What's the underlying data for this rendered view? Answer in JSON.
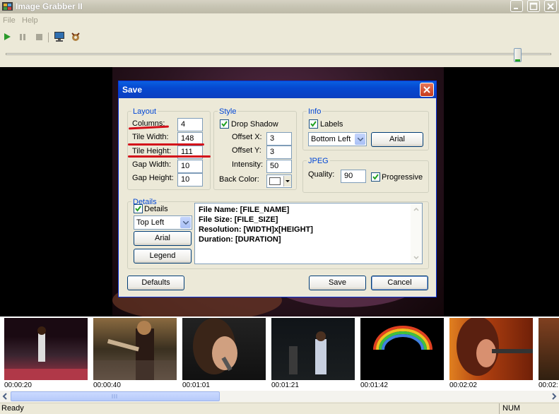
{
  "app": {
    "title": "Image Grabber II"
  },
  "menu": [
    "File",
    "Help"
  ],
  "toolbar": {
    "icons": [
      "play-icon",
      "pause-icon",
      "stop-icon",
      "monitor-icon",
      "settings-icon"
    ]
  },
  "seek": {
    "position": 0.94
  },
  "dialog": {
    "title": "Save",
    "layout": {
      "group": "Layout",
      "columns_label": "Columns:",
      "columns": "4",
      "tile_width_label": "Tile Width:",
      "tile_width": "148",
      "tile_height_label": "Tile Height:",
      "tile_height": "111",
      "gap_width_label": "Gap  Width:",
      "gap_width": "10",
      "gap_height_label": "Gap Height:",
      "gap_height": "10"
    },
    "style": {
      "group": "Style",
      "drop_shadow_label": "Drop Shadow",
      "drop_shadow_checked": true,
      "offset_x_label": "Offset X:",
      "offset_x": "3",
      "offset_y_label": "Offset Y:",
      "offset_y": "3",
      "intensity_label": "Intensity:",
      "intensity": "50",
      "back_color_label": "Back Color:"
    },
    "info": {
      "group": "Info",
      "labels_label": "Labels",
      "labels_checked": true,
      "position": "Bottom Left",
      "font_button": "Arial"
    },
    "jpeg": {
      "group": "JPEG",
      "quality_label": "Quality:",
      "quality": "90",
      "progressive_label": "Progressive",
      "progressive_checked": true
    },
    "details": {
      "group": "Details",
      "details_label": "Details",
      "details_checked": true,
      "position": "Top Left",
      "font_button": "Arial",
      "legend_button": "Legend",
      "template_lines": [
        "File Name: [FILE_NAME]",
        "File Size: [FILE_SIZE]",
        "Resolution: [WIDTH]x[HEIGHT]",
        "Duration: [DURATION]"
      ]
    },
    "buttons": {
      "defaults": "Defaults",
      "save": "Save",
      "cancel": "Cancel"
    }
  },
  "thumbnails": [
    {
      "time": "00:00:20"
    },
    {
      "time": "00:00:40"
    },
    {
      "time": "00:01:01"
    },
    {
      "time": "00:01:21"
    },
    {
      "time": "00:01:42"
    },
    {
      "time": "00:02:02"
    },
    {
      "time": "00:02:"
    }
  ],
  "status": {
    "text": "Ready",
    "num": "NUM"
  },
  "colors": {
    "accent": "#0046d5",
    "annotation": "#d3101a"
  }
}
